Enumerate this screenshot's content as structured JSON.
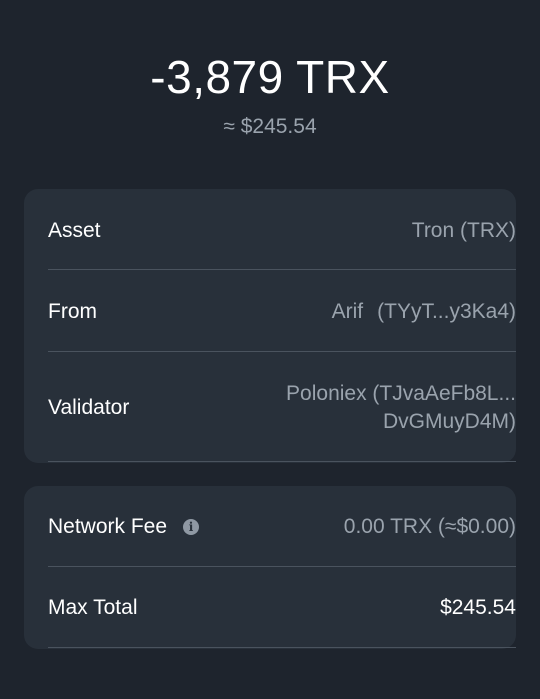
{
  "header": {
    "amount": "-3,879 TRX",
    "fiat": "≈ $245.54"
  },
  "details": {
    "asset_label": "Asset",
    "asset_value": "Tron (TRX)",
    "from_label": "From",
    "from_name": "Arif",
    "from_address": "(TYyT...y3Ka4)",
    "validator_label": "Validator",
    "validator_line1": "Poloniex (TJvaAeFb8L...",
    "validator_line2": "DvGMuyD4M)"
  },
  "fees": {
    "network_fee_label": "Network Fee",
    "network_fee_value": "0.00 TRX (≈$0.00)",
    "max_total_label": "Max Total",
    "max_total_value": "$245.54"
  },
  "icons": {
    "info": "info-icon"
  },
  "colors": {
    "background": "#1e242d",
    "card": "#28303a",
    "muted_text": "#9aa3ad"
  }
}
